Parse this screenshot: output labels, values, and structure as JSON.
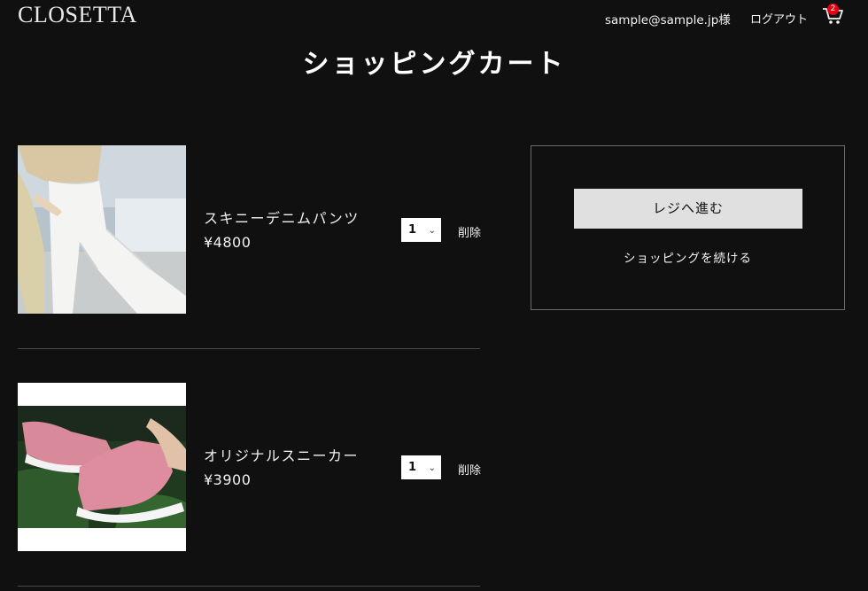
{
  "header": {
    "logo": "CLOSETTA",
    "user_email": "sample@sample.jp様",
    "logout": "ログアウト",
    "cart_count": "2"
  },
  "page_title": "ショッピングカート",
  "cart_items": [
    {
      "name": "スキニーデニムパンツ",
      "price": "¥4800",
      "quantity": "1",
      "delete": "削除"
    },
    {
      "name": "オリジナルスニーカー",
      "price": "¥3900",
      "quantity": "1",
      "delete": "削除"
    }
  ],
  "summary": {
    "checkout": "レジへ進む",
    "continue_shopping": "ショッピングを続ける"
  },
  "colors": {
    "background": "#101010",
    "badge": "#e60012",
    "button": "#e0e0e0"
  }
}
